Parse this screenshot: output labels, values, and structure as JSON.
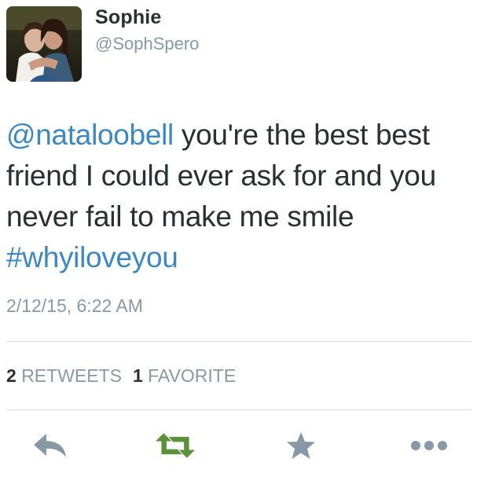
{
  "user": {
    "display_name": "Sophie",
    "handle": "@SophSpero",
    "avatar": "profile-photo"
  },
  "tweet": {
    "mention": "@nataloobell",
    "text": " you're the best best friend I could ever ask for and you never fail to make me smile ",
    "hashtag": "#whyiloveyou",
    "timestamp": "2/12/15, 6:22 AM"
  },
  "stats": {
    "retweets_count": "2",
    "retweets_label": "RETWEETS",
    "favorites_count": "1",
    "favorites_label": "FAVORITE"
  },
  "actions": [
    {
      "name": "reply",
      "icon": "reply-arrow-icon"
    },
    {
      "name": "retweet",
      "icon": "retweet-icon"
    },
    {
      "name": "favorite",
      "icon": "star-icon"
    },
    {
      "name": "more",
      "icon": "ellipsis-icon"
    }
  ],
  "colors": {
    "link": "#3b88c3",
    "text": "#292f33",
    "muted": "#8899a6",
    "action_icon": "#8899a6",
    "retweeted": "#5c913b",
    "divider": "#d8dde2"
  }
}
